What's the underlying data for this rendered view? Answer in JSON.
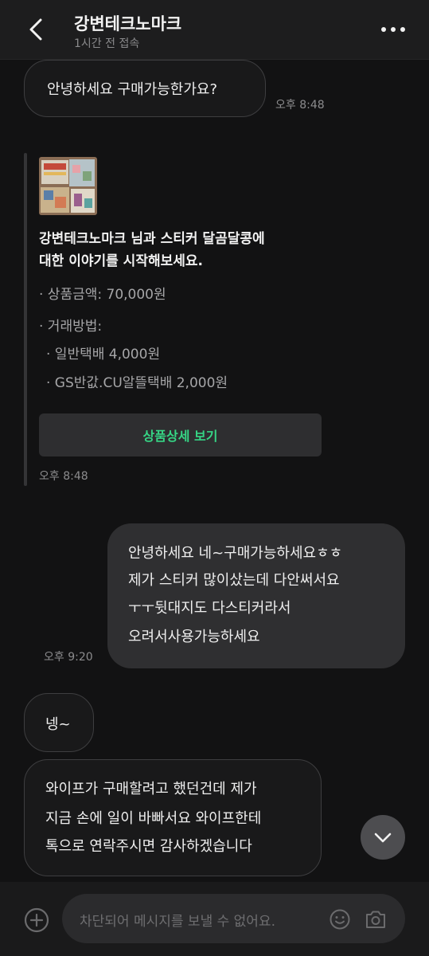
{
  "header": {
    "title": "강변테크노마크",
    "status": "1시간 전 접속",
    "back_icon": "chevron-left-icon",
    "more_icon": "more-horizontal-icon"
  },
  "messages": [
    {
      "direction": "incoming",
      "text": "안녕하세요 구매가능한가요?",
      "time": "오후 8:48"
    },
    {
      "direction": "outgoing",
      "lines": [
        "안녕하세요 네~구매가능하세요ㅎㅎ",
        "제가 스티커 많이샀는데 다안써서요",
        "ㅜㅜ뒷대지도 다스티커라서",
        "오려서사용가능하세요"
      ],
      "time": "오후 9:20"
    },
    {
      "direction": "incoming",
      "text": "넹~"
    },
    {
      "direction": "incoming",
      "lines": [
        "와이프가 구매할려고 했던건데 제가",
        "지금 손에 일이 바빠서요 와이프한테",
        "톡으로 연락주시면 감사하겠습니다"
      ]
    }
  ],
  "product_card": {
    "title_lines": [
      "강변테크노마크 님과 스티커 달곰달콩에",
      "대한 이야기를 시작해보세요."
    ],
    "price": "· 상품금액: 70,000원",
    "trade_label": "· 거래방법:",
    "trade_options": [
      "· 일반택배 4,000원",
      "· GS반값.CU알뜰택배 2,000원"
    ],
    "detail_button": "상품상세 보기",
    "time": "오후 8:48"
  },
  "input_bar": {
    "placeholder": "차단되어 메시지를 보낼 수 없어요.",
    "plus_icon": "plus-circle-icon",
    "emoji_icon": "emoji-icon",
    "camera_icon": "camera-icon"
  },
  "scroll_down_icon": "chevron-down-icon",
  "colors": {
    "accent_green": "#36d585",
    "background": "#121213",
    "bubble_outgoing": "#2f2f31"
  }
}
